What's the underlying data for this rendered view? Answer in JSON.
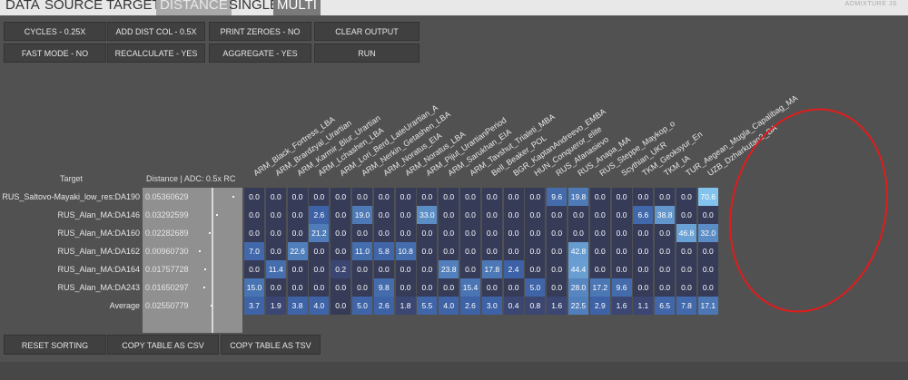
{
  "tabs": [
    {
      "label": "DATA",
      "state": "normal"
    },
    {
      "label": "SOURCE",
      "state": "normal"
    },
    {
      "label": "TARGET",
      "state": "normal"
    },
    {
      "label": "DISTANCE",
      "state": "active"
    },
    {
      "label": "SINGLE",
      "state": "normal"
    },
    {
      "label": "MULTI",
      "state": "selected"
    }
  ],
  "brand": "ADMIXTURE JS",
  "controls": {
    "cycles": "CYCLES - 0.25X",
    "add_dist_col": "ADD DIST COL - 0.5X",
    "print_zeroes": "PRINT ZEROES - NO",
    "clear_output": "CLEAR OUTPUT",
    "fast_mode": "FAST MODE - NO",
    "recalculate": "RECALCULATE - YES",
    "aggregate": "AGGREGATE - YES",
    "run": "RUN"
  },
  "table": {
    "target_header": "Target",
    "distance_header": "Distance | ADC: 0.5x RC",
    "columns": [
      "ARM_Black_Fortress_LBA",
      "ARM_Brardzyal_Urartian",
      "ARM_Karmir_Blur_Urartian",
      "ARM_Lchashen_LBA",
      "ARM_Lori_Berd_LateUrartian_A",
      "ARM_Nerkin_Getashen_LBA",
      "ARM_Noratus_EIA",
      "ARM_Noratus_LBA",
      "ARM_Pijut_UrartianPeriod",
      "ARM_Sarukhan_EIA",
      "ARM_Tavshut_Trialeti_MBA",
      "Bell_Beaker_POL",
      "BGR_KaptanAndreevo_EMBA",
      "HUN_Conqueror_elite",
      "RUS_Afanasievo",
      "RUS_Anapa_MA",
      "RUS_Steppe_Maykop_o",
      "Scythian_UKR",
      "TKM_Geoksyur_En",
      "TKM_IA",
      "TUR_Aegean_Mugla_Capalibag_MA",
      "UZB_Dzharkutan2_BA"
    ],
    "rows": [
      {
        "target": "RUS_Saltovo-Mayaki_low_res:DA190",
        "distance": "0.05360629",
        "dot": 0.9,
        "values": [
          "0.0",
          "0.0",
          "0.0",
          "0.0",
          "0.0",
          "0.0",
          "0.0",
          "0.0",
          "0.0",
          "0.0",
          "0.0",
          "0.0",
          "0.0",
          "0.0",
          "9.6",
          "19.8",
          "0.0",
          "0.0",
          "0.0",
          "0.0",
          "0.0",
          "70.6"
        ]
      },
      {
        "target": "RUS_Alan_MA:DA146",
        "distance": "0.03292599",
        "dot": 0.74,
        "values": [
          "0.0",
          "0.0",
          "0.0",
          "2.6",
          "0.0",
          "19.0",
          "0.0",
          "0.0",
          "33.0",
          "0.0",
          "0.0",
          "0.0",
          "0.0",
          "0.0",
          "0.0",
          "0.0",
          "0.0",
          "0.0",
          "6.6",
          "38.8",
          "0.0",
          "0.0"
        ]
      },
      {
        "target": "RUS_Alan_MA:DA160",
        "distance": "0.02282689",
        "dot": 0.66,
        "values": [
          "0.0",
          "0.0",
          "0.0",
          "21.2",
          "0.0",
          "0.0",
          "0.0",
          "0.0",
          "0.0",
          "0.0",
          "0.0",
          "0.0",
          "0.0",
          "0.0",
          "0.0",
          "0.0",
          "0.0",
          "0.0",
          "0.0",
          "0.0",
          "46.8",
          "32.0"
        ]
      },
      {
        "target": "RUS_Alan_MA:DA162",
        "distance": "0.00960730",
        "dot": 0.56,
        "values": [
          "7.0",
          "0.0",
          "22.6",
          "0.0",
          "0.0",
          "11.0",
          "5.8",
          "10.8",
          "0.0",
          "0.0",
          "0.0",
          "0.0",
          "0.0",
          "0.0",
          "0.0",
          "42.8",
          "0.0",
          "0.0",
          "0.0",
          "0.0",
          "0.0",
          "0.0"
        ]
      },
      {
        "target": "RUS_Alan_MA:DA164",
        "distance": "0.01757728",
        "dot": 0.62,
        "values": [
          "0.0",
          "11.4",
          "0.0",
          "0.0",
          "0.2",
          "0.0",
          "0.0",
          "0.0",
          "0.0",
          "23.8",
          "0.0",
          "17.8",
          "2.4",
          "0.0",
          "0.0",
          "44.4",
          "0.0",
          "0.0",
          "0.0",
          "0.0",
          "0.0",
          "0.0"
        ]
      },
      {
        "target": "RUS_Alan_MA:DA243",
        "distance": "0.01650297",
        "dot": 0.61,
        "values": [
          "15.0",
          "0.0",
          "0.0",
          "0.0",
          "0.0",
          "0.0",
          "9.8",
          "0.0",
          "0.0",
          "0.0",
          "15.4",
          "0.0",
          "0.0",
          "5.0",
          "0.0",
          "28.0",
          "17.2",
          "9.6",
          "0.0",
          "0.0",
          "0.0",
          "0.0"
        ]
      }
    ],
    "average": {
      "target": "Average",
      "distance": "0.02550779",
      "dot": 0.68,
      "values": [
        "3.7",
        "1.9",
        "3.8",
        "4.0",
        "0.0",
        "5.0",
        "2.6",
        "1.8",
        "5.5",
        "4.0",
        "2.6",
        "3.0",
        "0.4",
        "0.8",
        "1.6",
        "22.5",
        "2.9",
        "1.6",
        "1.1",
        "6.5",
        "7.8",
        "17.1"
      ]
    }
  },
  "bottom_buttons": {
    "reset_sorting": "RESET SORTING",
    "copy_csv": "COPY TABLE AS CSV",
    "copy_tsv": "COPY TABLE AS TSV"
  },
  "colors": {
    "cell_base": "#363b58",
    "cell_high": "#7fc4ee",
    "annotation": "#e01c1c"
  }
}
